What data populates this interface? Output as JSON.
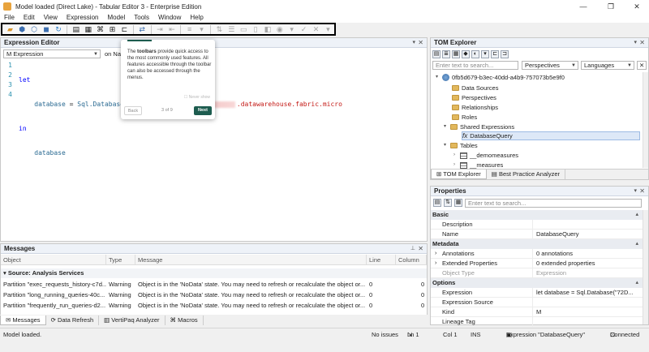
{
  "window": {
    "title": "Model loaded (Direct Lake) - Tabular Editor 3 - Enterprise Edition",
    "minimize": "—",
    "restore": "❐",
    "close": "✕"
  },
  "menu": [
    "File",
    "Edit",
    "View",
    "Expression",
    "Model",
    "Tools",
    "Window",
    "Help"
  ],
  "toolbar_icons": [
    "open-folder-icon",
    "cube-icon",
    "deploy-icon",
    "save-icon",
    "refresh-icon",
    "doc-icon",
    "grid-icon",
    "script-icon",
    "window-icon",
    "swap-icon",
    "indent-icon",
    "outdent-icon",
    "format-icon",
    "sort-icon",
    "list-icon",
    "comment-icon",
    "uncomment-icon",
    "bookmark-icon",
    "bulb-icon",
    "check-icon",
    "cancel-icon"
  ],
  "expression_editor": {
    "title": "Expression Editor",
    "mode_select": "M Expression",
    "on_label": "on Na",
    "code": {
      "line_numbers": [
        "1",
        "2",
        "3",
        "4"
      ],
      "l1_kw": "let",
      "l2_id": "database",
      "l2_eq": " = ",
      "l2_fn": "Sql.Database(",
      "l2_tail": ".datawarehouse.fabric.micro",
      "l3_kw": "in",
      "l4_id": "database"
    }
  },
  "popover": {
    "lead": "The ",
    "bold": "toolbars",
    "body": " provide quick access to the most commonly used features. All features accessible through the toolbar can also be accessed through the menus.",
    "never_show": "Never show",
    "back": "Back",
    "pages": "3 of 9",
    "next": "Next"
  },
  "messages": {
    "title": "Messages",
    "columns": [
      "Object",
      "Type",
      "Message",
      "Line",
      "Column"
    ],
    "group": "Source: Analysis Services",
    "rows": [
      {
        "object": "Partition \"exec_requests_history-c7d...",
        "type": "Warning",
        "message": "Object is in the 'NoData' state. You may need to refresh or recalculate the object or...",
        "line": "0",
        "column": "0"
      },
      {
        "object": "Partition \"long_running_queries-40c...",
        "type": "Warning",
        "message": "Object is in the 'NoData' state. You may need to refresh or recalculate the object or...",
        "line": "0",
        "column": "0"
      },
      {
        "object": "Partition \"frequently_run_queries-d2...",
        "type": "Warning",
        "message": "Object is in the 'NoData' state. You may need to refresh or recalculate the object or...",
        "line": "0",
        "column": "0"
      }
    ]
  },
  "bottom_tabs": [
    "Messages",
    "Data Refresh",
    "VertiPaq Analyzer",
    "Macros"
  ],
  "tom_explorer": {
    "title": "TOM Explorer",
    "search_placeholder": "Enter text to search...",
    "perspectives": "Perspectives",
    "languages": "Languages",
    "model_root": "0fb5d679-b3ec-40dd-a4b9-757073b5e9f0",
    "folders": [
      "Data Sources",
      "Perspectives",
      "Relationships",
      "Roles",
      "Shared Expressions"
    ],
    "shared_expression": "DatabaseQuery",
    "tables_label": "Tables",
    "tables": [
      "__demomeasures",
      "__measures"
    ],
    "tabs": [
      "TOM Explorer",
      "Best Practice Analyzer"
    ]
  },
  "properties": {
    "title": "Properties",
    "search_placeholder": "Enter text to search...",
    "cat_basic": "Basic",
    "description_label": "Description",
    "name_label": "Name",
    "name_value": "DatabaseQuery",
    "cat_metadata": "Metadata",
    "annotations_label": "Annotations",
    "annotations_value": "0 annotations",
    "ext_label": "Extended Properties",
    "ext_value": "0 extended properties",
    "objtype_label": "Object Type",
    "objtype_value": "Expression",
    "cat_options": "Options",
    "expression_label": "Expression",
    "expression_value": "let    database = Sql.Database(\"72D...",
    "exprsource_label": "Expression Source",
    "kind_label": "Kind",
    "kind_value": "M",
    "lineage_label": "Lineage Tag"
  },
  "status": {
    "left": "Model loaded.",
    "issues": "No issues",
    "ln": "Ln 1",
    "col": "Col 1",
    "ins": "INS",
    "expression": "Expression \"DatabaseQuery\"",
    "connected": "Connected"
  }
}
